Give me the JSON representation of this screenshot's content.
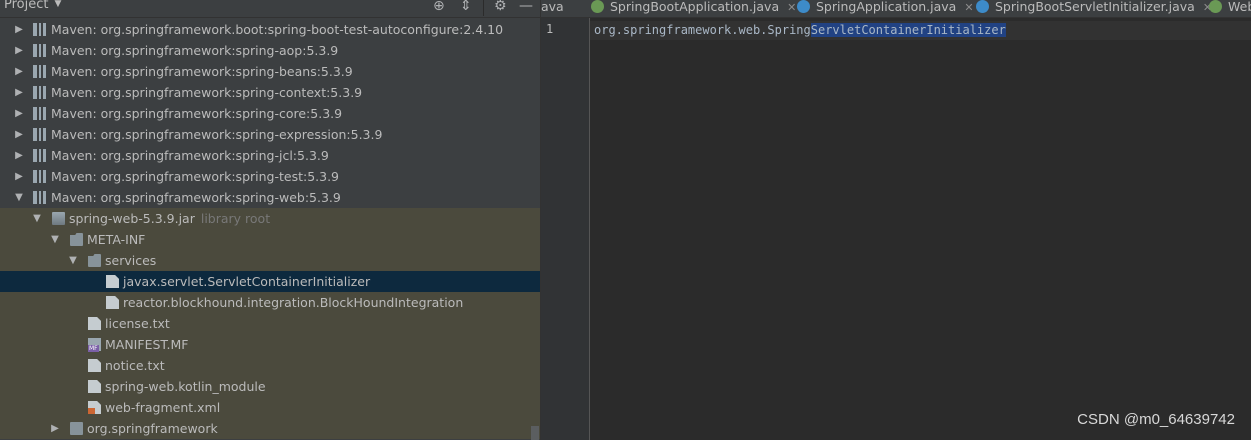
{
  "project_panel": {
    "title": "Project",
    "header_icons": [
      "target-icon",
      "collapse-icon",
      "gear-icon",
      "minimize-icon"
    ]
  },
  "tree": {
    "maven_libraries": [
      "Maven: org.springframework.boot:spring-boot-test-autoconfigure:2.4.10",
      "Maven: org.springframework:spring-aop:5.3.9",
      "Maven: org.springframework:spring-beans:5.3.9",
      "Maven: org.springframework:spring-context:5.3.9",
      "Maven: org.springframework:spring-core:5.3.9",
      "Maven: org.springframework:spring-expression:5.3.9",
      "Maven: org.springframework:spring-jcl:5.3.9",
      "Maven: org.springframework:spring-test:5.3.9",
      "Maven: org.springframework:spring-web:5.3.9"
    ],
    "jar": {
      "label": "spring-web-5.3.9.jar",
      "hint": "library root"
    },
    "meta_inf": "META-INF",
    "services": "services",
    "service_files": [
      "javax.servlet.ServletContainerInitializer",
      "reactor.blockhound.integration.BlockHoundIntegration"
    ],
    "meta_files": [
      {
        "label": "license.txt",
        "icon": "text-file-icon"
      },
      {
        "label": "MANIFEST.MF",
        "icon": "manifest-file-icon"
      },
      {
        "label": "notice.txt",
        "icon": "text-file-icon"
      },
      {
        "label": "spring-web.kotlin_module",
        "icon": "text-file-icon"
      },
      {
        "label": "web-fragment.xml",
        "icon": "xml-file-icon"
      }
    ],
    "package": "org.springframework"
  },
  "tabs": [
    {
      "label": "ava",
      "icon": ""
    },
    {
      "label": "SpringBootApplication.java",
      "icon": "annotation-icon"
    },
    {
      "label": "SpringApplication.java",
      "icon": "class-icon"
    },
    {
      "label": "SpringBootServletInitializer.java",
      "icon": "class-icon"
    },
    {
      "label": "Web",
      "icon": "interface-icon"
    }
  ],
  "editor": {
    "line_number": "1",
    "code_plain": "org.springframework.web.Spring",
    "code_selected": "ServletContainerInitializer"
  },
  "watermark": "CSDN @m0_64639742",
  "colors": {
    "panel_bg": "#3c3f41",
    "editor_bg": "#2b2b2b",
    "library_root_bg": "#4b4a3d",
    "selection_bg": "#0d293e",
    "text_selection": "#214283"
  }
}
